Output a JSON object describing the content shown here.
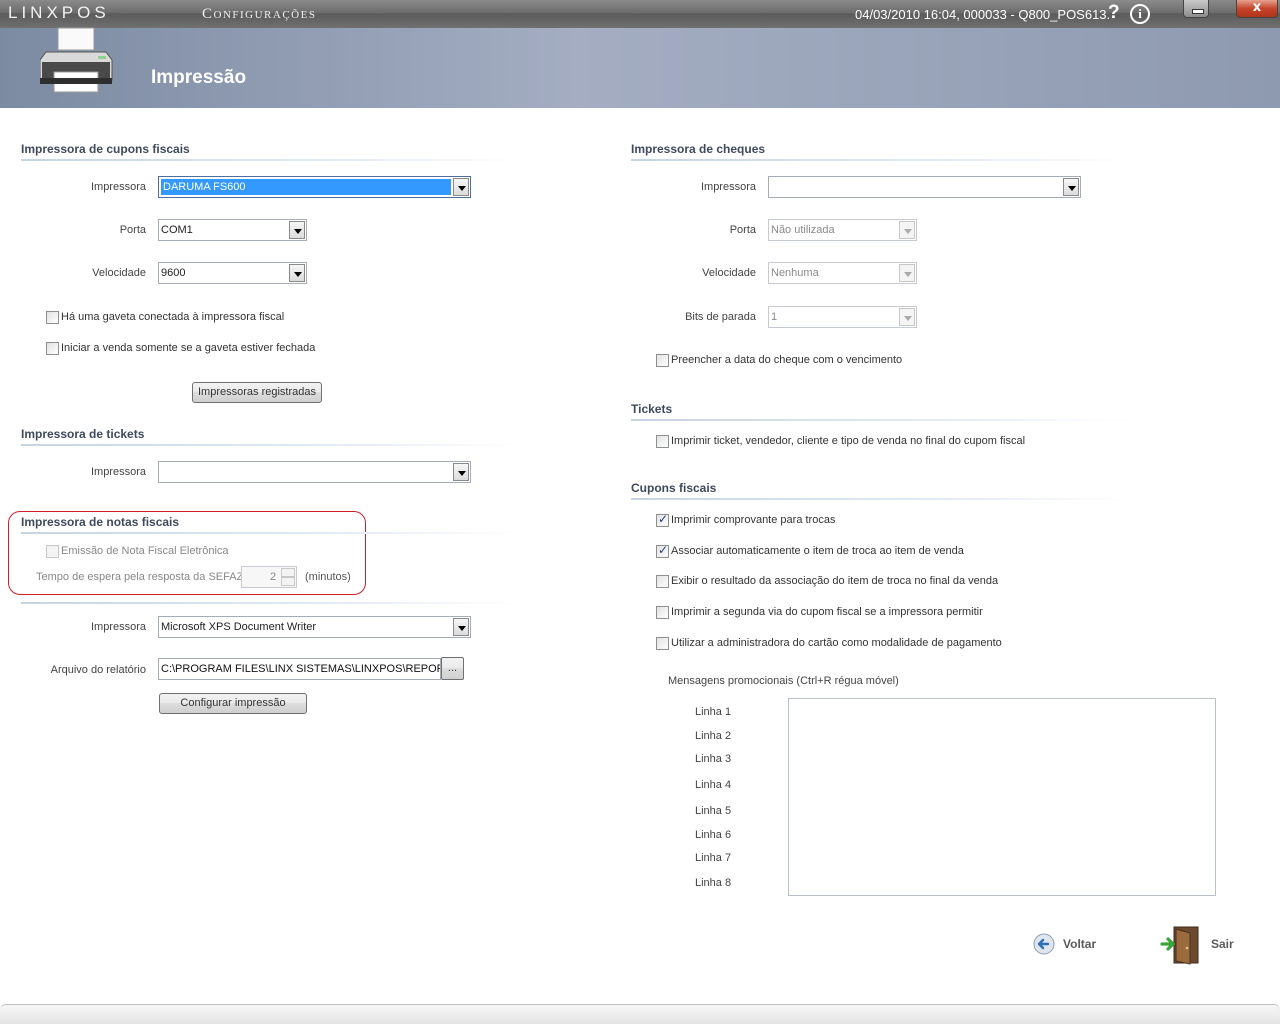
{
  "titlebar": {
    "brand": "LINXPOS",
    "app_title": "Configurações",
    "status": "04/03/2010 16:04, 000033 - Q800_POS613.",
    "help_glyph": "?",
    "info_glyph": "i",
    "close_glyph": "x"
  },
  "header": {
    "title": "Impressão",
    "icon": "printer-icon"
  },
  "left": {
    "fiscal": {
      "title": "Impressora de cupons fiscais",
      "printer_label": "Impressora",
      "printer_value": "DARUMA FS600",
      "port_label": "Porta",
      "port_value": "COM1",
      "speed_label": "Velocidade",
      "speed_value": "9600",
      "drawer_check": {
        "label": "Há uma gaveta conectada à impressora fiscal",
        "checked": false
      },
      "closed_drawer_check": {
        "label": "Iniciar a venda somente se a gaveta estiver fechada",
        "checked": false
      },
      "registered_button": "Impressoras registradas"
    },
    "tickets": {
      "title": "Impressora de tickets",
      "printer_label": "Impressora",
      "printer_value": ""
    },
    "invoices": {
      "title": "Impressora de notas fiscais",
      "nfe_check": {
        "label": "Emissão de Nota Fiscal Eletrônica",
        "checked": false
      },
      "wait_label": "Tempo de espera pela resposta da SEFAZ",
      "wait_value": "2",
      "wait_unit": "(minutos)"
    },
    "report": {
      "printer_label": "Impressora",
      "printer_value": "Microsoft XPS Document Writer",
      "file_label": "Arquivo do relatório",
      "file_value": "C:\\PROGRAM FILES\\LINX SISTEMAS\\LINXPOS\\REPORTS\\I",
      "browse_label": "...",
      "configure_button": "Configurar impressão"
    }
  },
  "right": {
    "cheques": {
      "title": "Impressora de cheques",
      "printer_label": "Impressora",
      "printer_value": "",
      "port_label": "Porta",
      "port_value": "Não utilizada",
      "speed_label": "Velocidade",
      "speed_value": "Nenhuma",
      "stopbits_label": "Bits de parada",
      "stopbits_value": "1",
      "fill_date_check": {
        "label": "Preencher a data do cheque com o vencimento",
        "checked": false
      }
    },
    "tickets": {
      "title": "Tickets",
      "print_ticket_check": {
        "label": "Imprimir ticket, vendedor, cliente e tipo de venda  no final do cupom fiscal",
        "checked": false
      }
    },
    "cupons": {
      "title": "Cupons fiscais",
      "checks": [
        {
          "label": "Imprimir comprovante para trocas",
          "checked": true
        },
        {
          "label": "Associar automaticamente o item de troca ao item de venda",
          "checked": true
        },
        {
          "label": "Exibir o resultado da associação do item de troca no final da venda",
          "checked": false
        },
        {
          "label": "Imprimir a segunda via do cupom fiscal se a impressora permitir",
          "checked": false
        },
        {
          "label": "Utilizar a administradora do cartão como modalidade de pagamento",
          "checked": false
        }
      ],
      "messages_label": "Mensagens promocionais (Ctrl+R régua móvel)",
      "lines": [
        "Linha 1",
        "Linha 2",
        "Linha 3",
        "Linha 4",
        "Linha 5",
        "Linha 6",
        "Linha 7",
        "Linha 8"
      ]
    }
  },
  "actions": {
    "back": "Voltar",
    "exit": "Sair"
  }
}
